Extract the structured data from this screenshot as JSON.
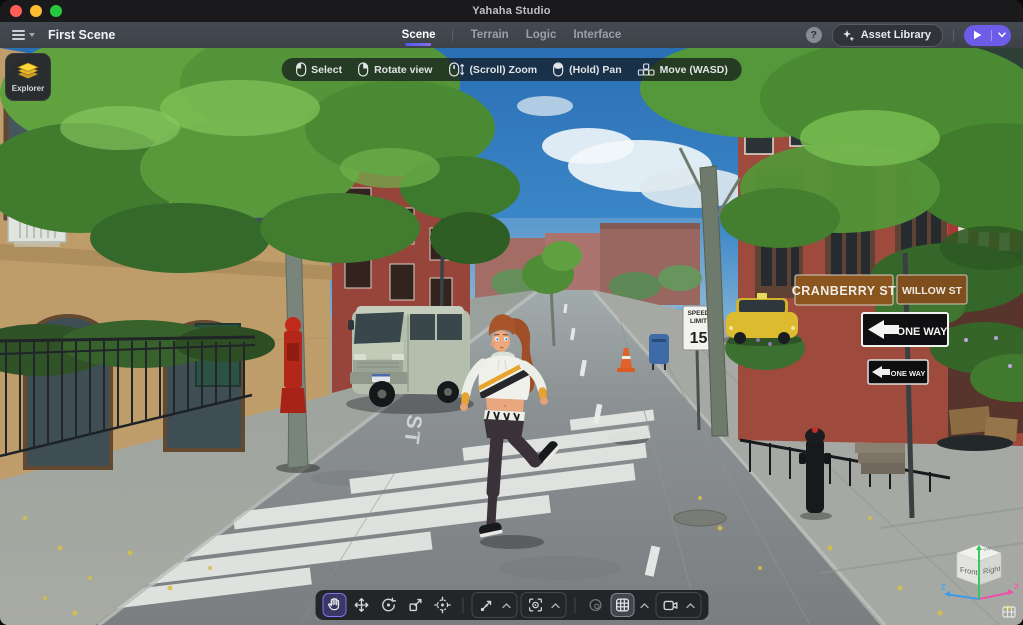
{
  "titlebar": {
    "title": "Yahaha Studio"
  },
  "appbar": {
    "scene_name": "First Scene",
    "tabs": [
      {
        "label": "Scene",
        "active": true
      },
      {
        "label": "Terrain",
        "active": false
      },
      {
        "label": "Logic",
        "active": false
      },
      {
        "label": "Interface",
        "active": false
      }
    ],
    "help_label": "?",
    "asset_library_label": "Asset Library"
  },
  "explorer_button": {
    "label": "Explorer"
  },
  "viewport_hints": [
    {
      "icon": "mouse-left-icon",
      "label": "Select"
    },
    {
      "icon": "mouse-right-icon",
      "label": "Rotate view"
    },
    {
      "icon": "mouse-scroll-icon",
      "label": "(Scroll) Zoom"
    },
    {
      "icon": "mouse-hold-icon",
      "label": "(Hold) Pan"
    },
    {
      "icon": "wasd-keys-icon",
      "label": "Move (WASD)"
    }
  ],
  "bottom_toolbar": {
    "tools": [
      "pan-hand",
      "move",
      "rotate",
      "scale",
      "transform",
      "path-snap",
      "focus",
      "sphere",
      "grid",
      "camera"
    ],
    "active_tool": "pan-hand",
    "lit_tool": "grid"
  },
  "scene": {
    "street_signs": {
      "cranberry": "CRANBERRY ST",
      "willow": "WILLOW ST",
      "one_way_large": "ONE WAY",
      "one_way_small": "ONE WAY",
      "speed_limit_top": "SPEED",
      "speed_limit_mid": "LIMIT",
      "speed_limit_value": "15"
    },
    "road_marking": "ST"
  },
  "view_cube": {
    "front_label": "Front",
    "right_label": "Right",
    "top_label": "Top",
    "x_axis_label": "X",
    "z_axis_label": "Z"
  },
  "colors": {
    "accent_purple": "#6C5CE7",
    "tab_underline": "#6F63EE",
    "titlebar_bg": "#1A1A1C",
    "appbar_bg": "#40444B",
    "sky_blue": "#2F7FC2",
    "tree_green": "#5FA23E",
    "brick_red": "#9E4A3C",
    "sign_brown": "#8A551F",
    "taxi_yellow": "#DCBB2E",
    "explorer_gold": "#FFD83B"
  }
}
